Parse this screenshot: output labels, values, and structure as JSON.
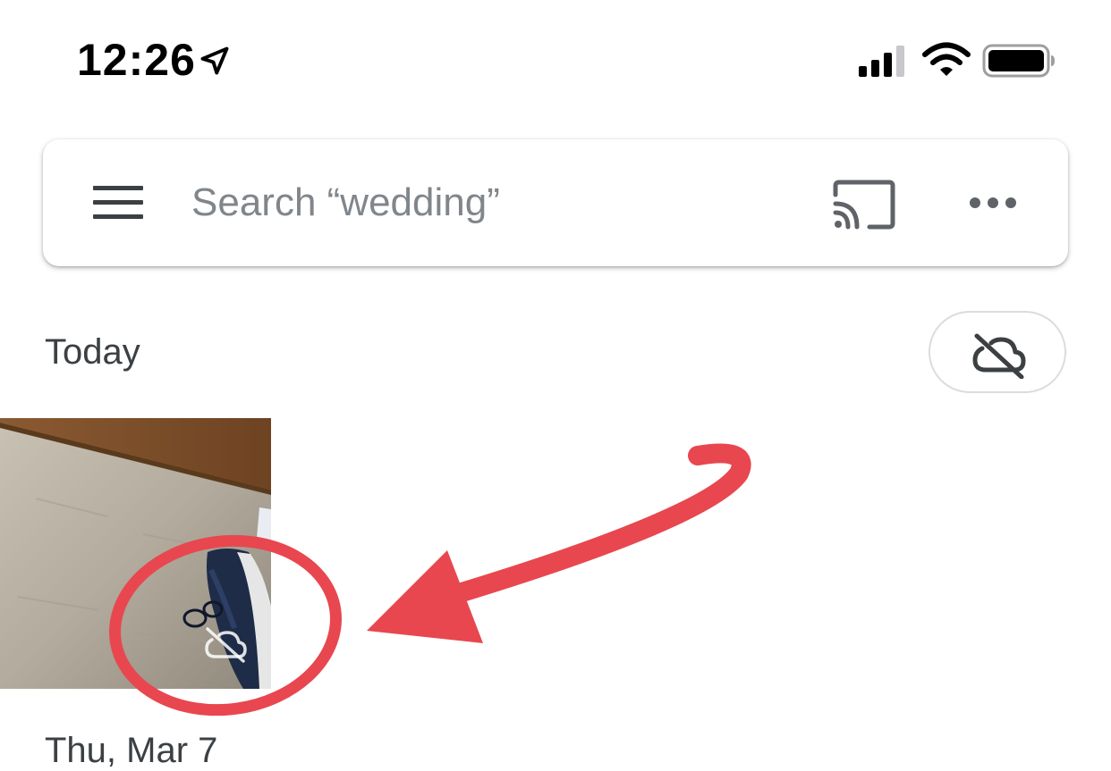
{
  "status_bar": {
    "time": "12:26",
    "icons": [
      "location-arrow-icon",
      "cellular-signal-icon",
      "wifi-icon",
      "battery-icon"
    ]
  },
  "search_bar": {
    "menu_icon": "hamburger-menu-icon",
    "placeholder": "Search “wedding”",
    "value": "",
    "cast_icon": "cast-icon",
    "more_icon": "more-horizontal-icon"
  },
  "sections": [
    {
      "title": "Today",
      "backup_icon": "cloud-off-icon",
      "photo_badge_icon": "cloud-off-icon"
    },
    {
      "title": "Thu, Mar 7"
    }
  ],
  "annotation": {
    "color": "#e8474f",
    "marks": [
      "red-circle-highlight",
      "red-arrow-pointer"
    ]
  },
  "colors": {
    "text_primary": "#3c4043",
    "icon_gray": "#5f6368",
    "placeholder": "#80868b",
    "annotation_red": "#e8474f"
  }
}
